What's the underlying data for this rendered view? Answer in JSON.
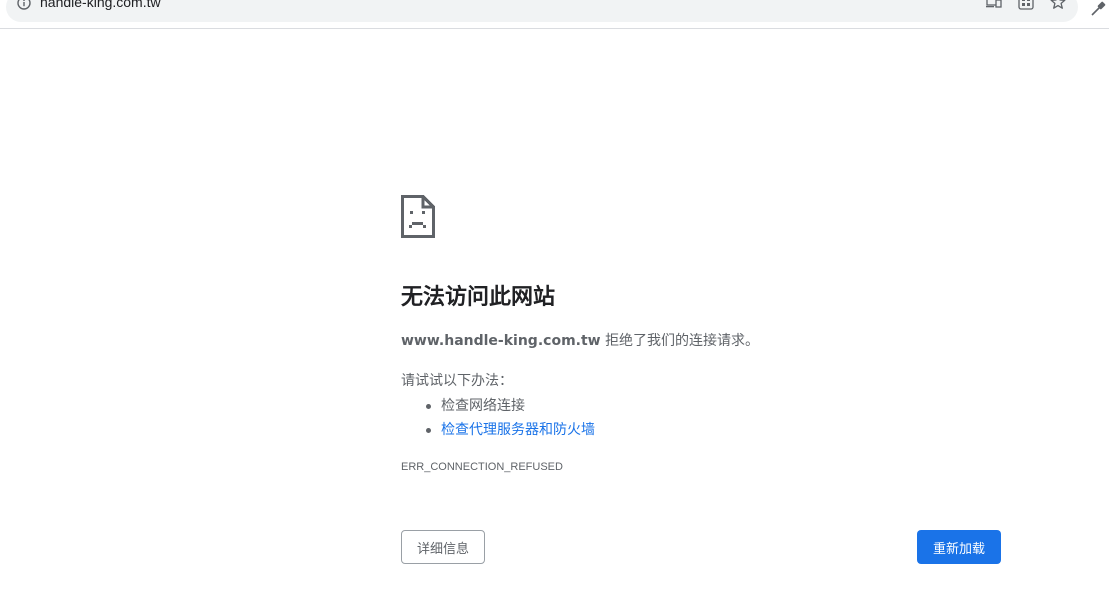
{
  "address_bar": {
    "url": "handle-king.com.tw",
    "icons": [
      "info-icon",
      "cast-icon",
      "qr-code-icon",
      "star-icon",
      "eyedropper-icon"
    ]
  },
  "error": {
    "icon": "sad-page-icon",
    "title": "无法访问此网站",
    "host": "www.handle-king.com.tw",
    "message": "拒绝了我们的连接请求。",
    "try_label": "请试试以下办法：",
    "suggestions": [
      {
        "text": "检查网络连接",
        "is_link": false
      },
      {
        "text": "检查代理服务器和防火墙",
        "is_link": true
      }
    ],
    "code": "ERR_CONNECTION_REFUSED"
  },
  "buttons": {
    "details_label": "详细信息",
    "reload_label": "重新加载"
  },
  "colors": {
    "accent": "#1a73e8",
    "text_primary": "#202124",
    "text_secondary": "#5f6368"
  }
}
